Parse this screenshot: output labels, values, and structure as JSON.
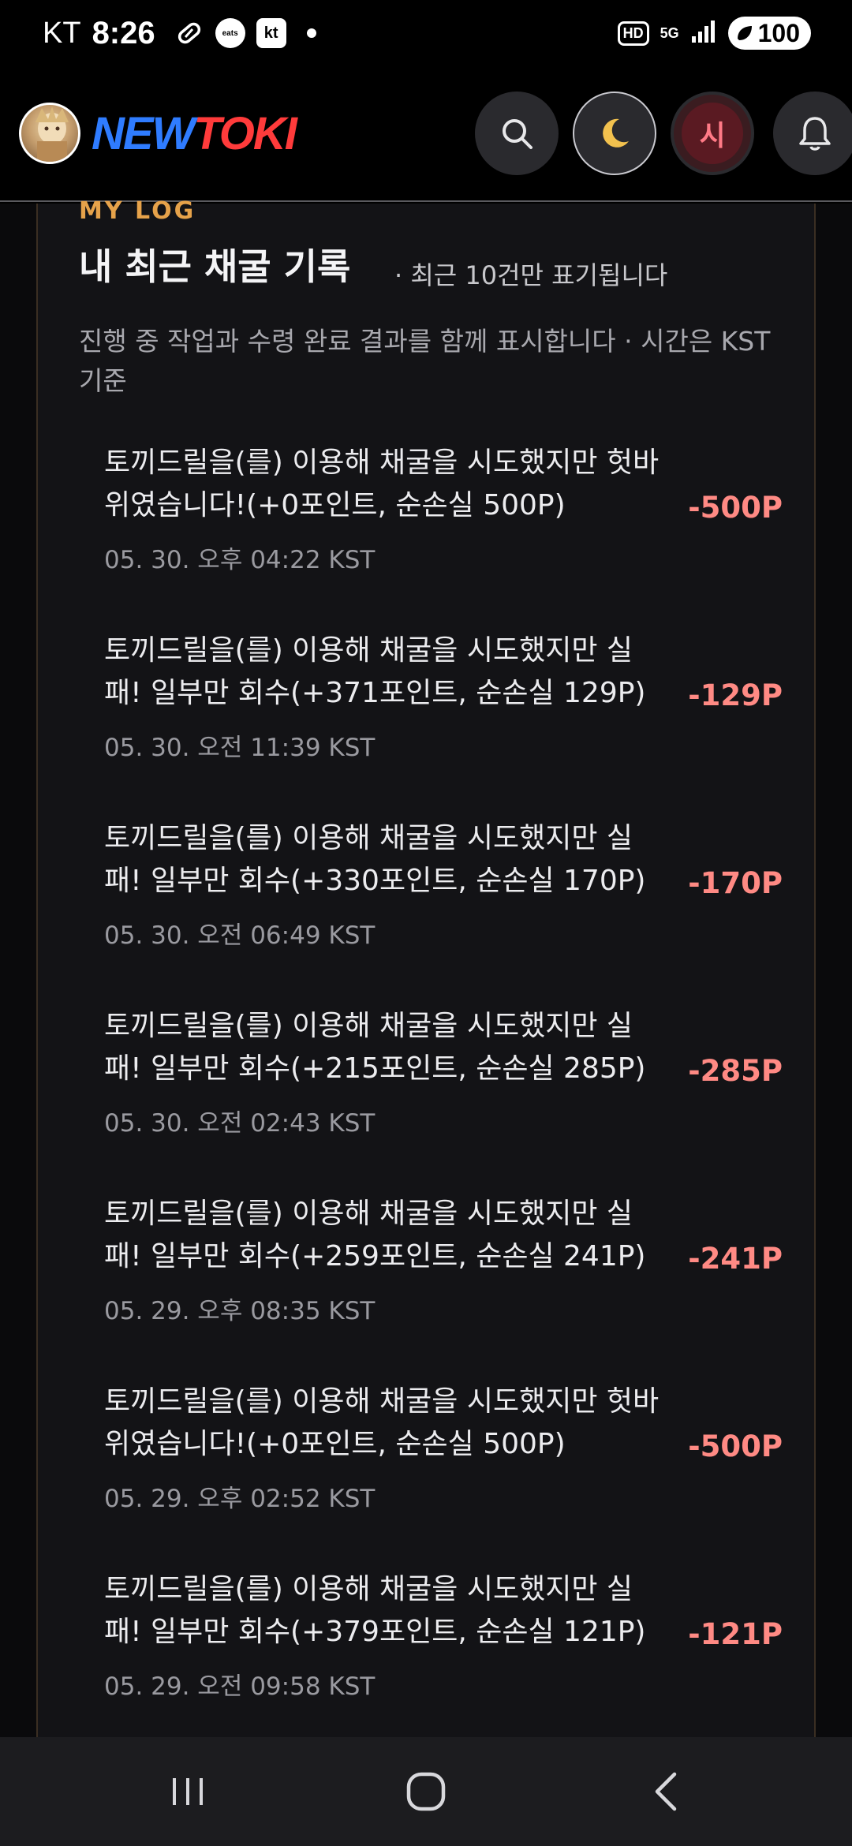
{
  "status_bar": {
    "carrier": "KT",
    "time": "8:26",
    "eats_label": "eats",
    "kt_label": "kt",
    "hd_label": "HD",
    "network_label": "5G",
    "battery": "100"
  },
  "header": {
    "logo_part1": "NEW",
    "logo_part2": "TOKI",
    "user_initial": "시",
    "theme_glyph": "🌙"
  },
  "section": {
    "eyebrow": "MY LOG",
    "title": "내 최근 채굴 기록",
    "title_note": "· 최근 10건만 표기됩니다",
    "description": "진행 중 작업과 수령 완료 결과를 함께 표시합니다 · 시간은 KST 기준"
  },
  "logs": [
    {
      "message": "토끼드릴을(를) 이용해 채굴을 시도했지만 헛바위였습니다!(+0포인트, 순손실 500P)",
      "time": "05. 30. 오후 04:22 KST",
      "amount": "-500P"
    },
    {
      "message": "토끼드릴을(를) 이용해 채굴을 시도했지만 실패! 일부만 회수(+371포인트, 순손실 129P)",
      "time": "05. 30. 오전 11:39 KST",
      "amount": "-129P"
    },
    {
      "message": "토끼드릴을(를) 이용해 채굴을 시도했지만 실패! 일부만 회수(+330포인트, 순손실 170P)",
      "time": "05. 30. 오전 06:49 KST",
      "amount": "-170P"
    },
    {
      "message": "토끼드릴을(를) 이용해 채굴을 시도했지만 실패! 일부만 회수(+215포인트, 순손실 285P)",
      "time": "05. 30. 오전 02:43 KST",
      "amount": "-285P"
    },
    {
      "message": "토끼드릴을(를) 이용해 채굴을 시도했지만 실패! 일부만 회수(+259포인트, 순손실 241P)",
      "time": "05. 29. 오후 08:35 KST",
      "amount": "-241P"
    },
    {
      "message": "토끼드릴을(를) 이용해 채굴을 시도했지만 헛바위였습니다!(+0포인트, 순손실 500P)",
      "time": "05. 29. 오후 02:52 KST",
      "amount": "-500P"
    },
    {
      "message": "토끼드릴을(를) 이용해 채굴을 시도했지만 실패! 일부만 회수(+379포인트, 순손실 121P)",
      "time": "05. 29. 오전 09:58 KST",
      "amount": "-121P"
    }
  ],
  "colors": {
    "accent": "#e6a24a",
    "loss": "#ff8a84",
    "logo_blue": "#2f7cff",
    "logo_red": "#ff3b3b"
  }
}
